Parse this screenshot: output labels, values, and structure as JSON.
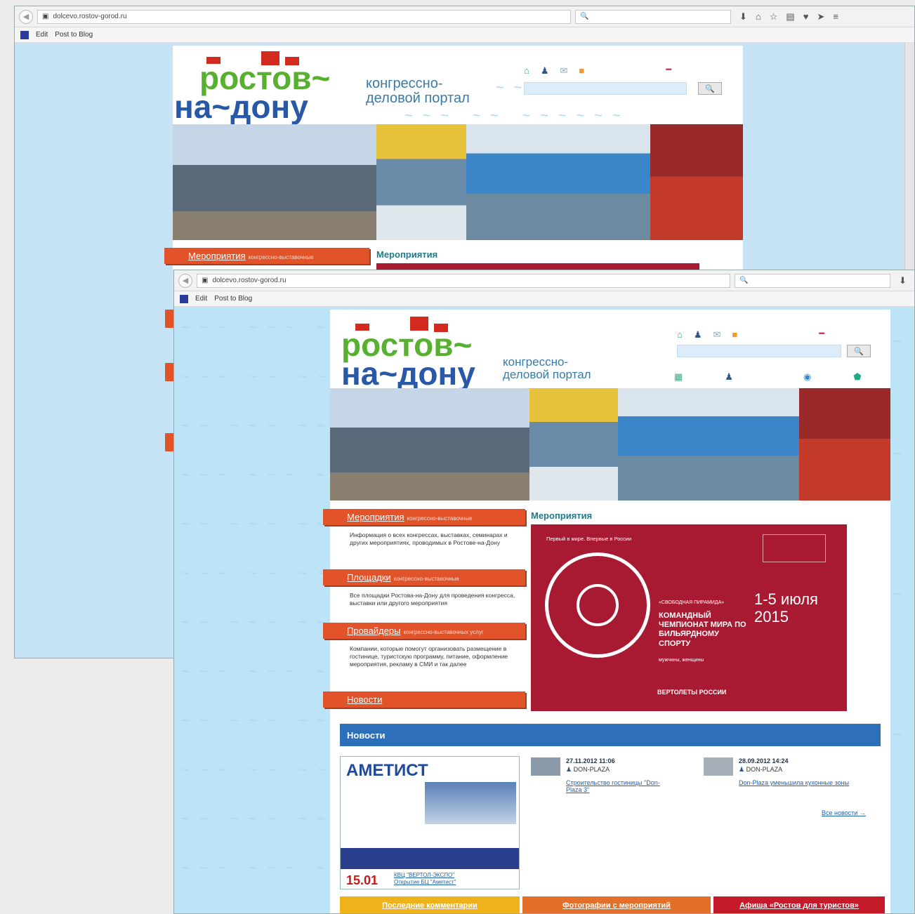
{
  "browser": {
    "url": "dolcevo.rostov-gorod.ru",
    "bookmarks": [
      "Edit",
      "Post to Blog"
    ]
  },
  "site": {
    "logo_line1": "ростов~",
    "logo_line2": "на~дону",
    "portal_line1": "конгрессно-",
    "portal_line2": "деловой портал"
  },
  "menu": [
    {
      "title": "Мероприятия",
      "sub": "конгрессно-выставочные",
      "desc": "Информация о всех конгрессах, выставках, семинарах и других мероприятиях, проводимых в Ростове-на-Дону"
    },
    {
      "title": "Площадки",
      "sub": "конгрессно-выставочные",
      "desc": "Все площадки Ростова-на-Дону для проведения конгресса, выставки или другого мероприятия"
    },
    {
      "title": "Провайдеры",
      "sub": "конгрессно-выставочных услуг",
      "desc": "Компании, которые помогут организовать размещение в гостинице, туристскую программу, питание, оформление мероприятия, рекламу в СМИ и так далее"
    },
    {
      "title": "Новости",
      "sub": "",
      "desc": ""
    }
  ],
  "events": {
    "title": "Мероприятия",
    "banner_top": "Первый в мире. Впервые в России",
    "banner_event": "«СВОБОДНАЯ ПИРАМИДА»",
    "banner_name": "КОМАНДНЫЙ ЧЕМПИОНАТ МИРА ПО БИЛЬЯРДНОМУ СПОРТУ",
    "banner_sub": "мужчины, женщины",
    "banner_dates": "1-5 июля 2015",
    "banner_sponsor": "ВЕРТОЛЕТЫ РОССИИ"
  },
  "news": {
    "title": "Новости",
    "ad_brand": "АМЕТИСТ",
    "ad_date": "15.01",
    "ad_link1": "КВЦ \"ВЕРТОЛ-ЭКСПО\"",
    "ad_link2": "Открытие БЦ \"Аметист\"",
    "items": [
      {
        "date": "27.11.2012 11:06",
        "org": "DON-PLAZA",
        "link": "Строительство гостиницы \"Don-Plaza 3\""
      },
      {
        "date": "28.09.2012 14:24",
        "org": "DON-PLAZA",
        "link": "Don-Plaza уменьшила кухонные зоны"
      }
    ],
    "all_news": "Все новости →"
  },
  "bottom_tabs": [
    "Последние комментарии",
    "Фотографии с мероприятий",
    "Афиша «Ростов для туристов»"
  ],
  "colors": {
    "orange": "#e2532a",
    "crimson": "#a71a32",
    "blue": "#2d6fb8"
  }
}
